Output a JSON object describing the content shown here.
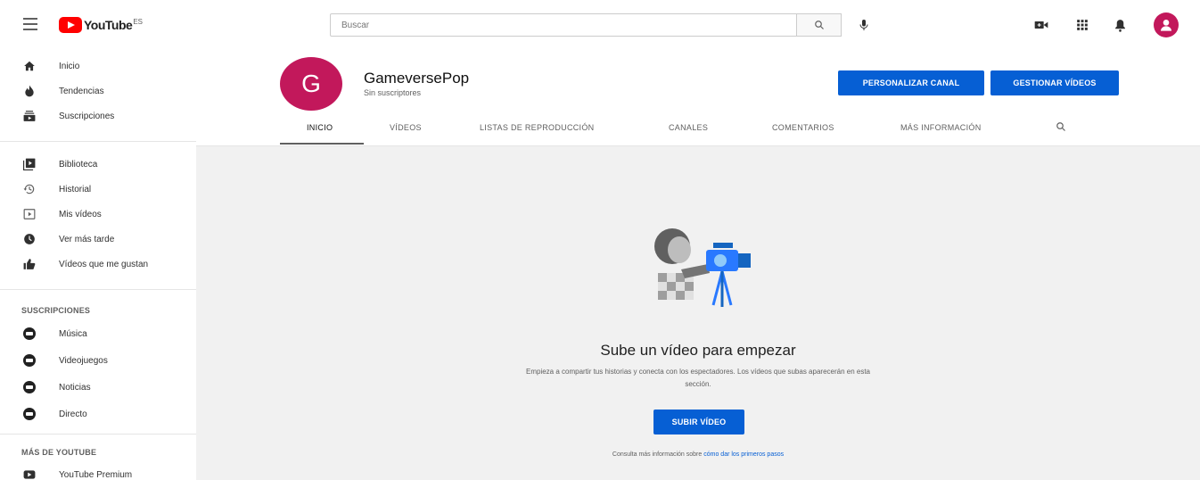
{
  "header": {
    "logo_text": "YouTube",
    "logo_region": "ES",
    "search_placeholder": "Buscar"
  },
  "sidebar": {
    "primary": [
      {
        "label": "Inicio",
        "icon": "home-icon"
      },
      {
        "label": "Tendencias",
        "icon": "trending-icon"
      },
      {
        "label": "Suscripciones",
        "icon": "subscriptions-icon"
      }
    ],
    "library": [
      {
        "label": "Biblioteca",
        "icon": "library-icon"
      },
      {
        "label": "Historial",
        "icon": "history-icon"
      },
      {
        "label": "Mis vídeos",
        "icon": "my-videos-icon"
      },
      {
        "label": "Ver más tarde",
        "icon": "watch-later-icon"
      },
      {
        "label": "Vídeos que me gustan",
        "icon": "liked-icon"
      }
    ],
    "subscriptions_heading": "SUSCRIPCIONES",
    "subscriptions": [
      {
        "label": "Música"
      },
      {
        "label": "Videojuegos"
      },
      {
        "label": "Noticias"
      },
      {
        "label": "Directo"
      }
    ],
    "more_heading": "MÁS DE YOUTUBE",
    "more": [
      {
        "label": "YouTube Premium",
        "icon": "youtube-premium-icon"
      }
    ]
  },
  "channel": {
    "avatar_letter": "G",
    "name": "GameversePop",
    "subscribers": "Sin suscriptores",
    "customize_button": "PERSONALIZAR CANAL",
    "manage_button": "GESTIONAR VÍDEOS",
    "tabs": [
      {
        "label": "INICIO"
      },
      {
        "label": "VÍDEOS"
      },
      {
        "label": "LISTAS DE REPRODUCCIÓN"
      },
      {
        "label": "CANALES"
      },
      {
        "label": "COMENTARIOS"
      },
      {
        "label": "MÁS INFORMACIÓN"
      }
    ]
  },
  "empty_state": {
    "title": "Sube un vídeo para empezar",
    "description": "Empieza a compartir tus historias y conecta con los espectadores. Los vídeos que subas aparecerán en esta sección.",
    "upload_button": "SUBIR VÍDEO",
    "footer_text": "Consulta más información sobre",
    "footer_link": "cómo dar los primeros pasos"
  },
  "colors": {
    "brand_red": "#ff0000",
    "accent_blue": "#065fd4",
    "avatar_pink": "#c2185b"
  }
}
